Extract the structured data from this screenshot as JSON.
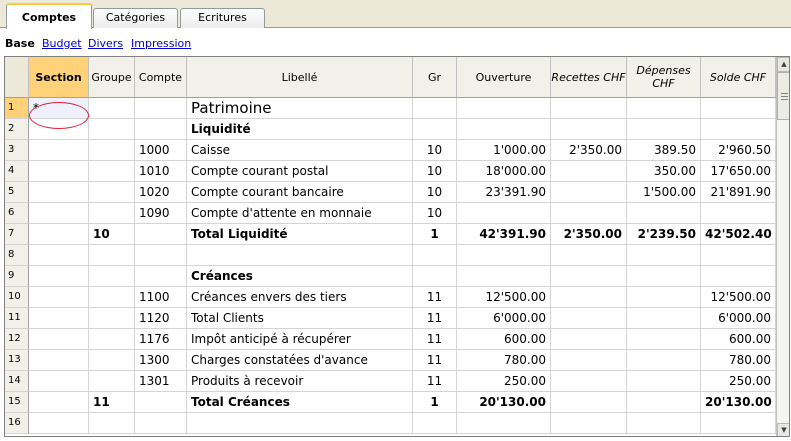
{
  "tabs": [
    {
      "label": "Comptes",
      "active": true
    },
    {
      "label": "Catégories",
      "active": false
    },
    {
      "label": "Ecritures",
      "active": false
    }
  ],
  "views": {
    "current": "Base",
    "links": [
      "Budget",
      "Divers",
      "Impression"
    ]
  },
  "table": {
    "columns": {
      "section": "Section",
      "groupe": "Groupe",
      "compte": "Compte",
      "libelle": "Libellé",
      "gr": "Gr",
      "ouverture": "Ouverture",
      "recettes": "Recettes CHF",
      "depenses": "Dépenses CHF",
      "solde": "Solde CHF"
    },
    "rows": [
      {
        "num": "1",
        "section": "*",
        "groupe": "",
        "compte": "",
        "libelle": "Patrimoine",
        "gr": "",
        "ouverture": "",
        "recettes": "",
        "depenses": "",
        "solde": ""
      },
      {
        "num": "2",
        "section": "",
        "groupe": "",
        "compte": "",
        "libelle": "Liquidité",
        "gr": "",
        "ouverture": "",
        "recettes": "",
        "depenses": "",
        "solde": ""
      },
      {
        "num": "3",
        "section": "",
        "groupe": "",
        "compte": "1000",
        "libelle": "Caisse",
        "gr": "10",
        "ouverture": "1'000.00",
        "recettes": "2'350.00",
        "depenses": "389.50",
        "solde": "2'960.50"
      },
      {
        "num": "4",
        "section": "",
        "groupe": "",
        "compte": "1010",
        "libelle": "Compte courant postal",
        "gr": "10",
        "ouverture": "18'000.00",
        "recettes": "",
        "depenses": "350.00",
        "solde": "17'650.00"
      },
      {
        "num": "5",
        "section": "",
        "groupe": "",
        "compte": "1020",
        "libelle": "Compte courant bancaire",
        "gr": "10",
        "ouverture": "23'391.90",
        "recettes": "",
        "depenses": "1'500.00",
        "solde": "21'891.90"
      },
      {
        "num": "6",
        "section": "",
        "groupe": "",
        "compte": "1090",
        "libelle": "Compte d'attente en monnaie",
        "gr": "10",
        "ouverture": "",
        "recettes": "",
        "depenses": "",
        "solde": ""
      },
      {
        "num": "7",
        "section": "",
        "groupe": "10",
        "compte": "",
        "libelle": "Total Liquidité",
        "gr": "1",
        "ouverture": "42'391.90",
        "recettes": "2'350.00",
        "depenses": "2'239.50",
        "solde": "42'502.40"
      },
      {
        "num": "8",
        "section": "",
        "groupe": "",
        "compte": "",
        "libelle": "",
        "gr": "",
        "ouverture": "",
        "recettes": "",
        "depenses": "",
        "solde": ""
      },
      {
        "num": "9",
        "section": "",
        "groupe": "",
        "compte": "",
        "libelle": "Créances",
        "gr": "",
        "ouverture": "",
        "recettes": "",
        "depenses": "",
        "solde": ""
      },
      {
        "num": "10",
        "section": "",
        "groupe": "",
        "compte": "1100",
        "libelle": "Créances envers des tiers",
        "gr": "11",
        "ouverture": "12'500.00",
        "recettes": "",
        "depenses": "",
        "solde": "12'500.00"
      },
      {
        "num": "11",
        "section": "",
        "groupe": "",
        "compte": "1120",
        "libelle": "Total Clients",
        "gr": "11",
        "ouverture": "6'000.00",
        "recettes": "",
        "depenses": "",
        "solde": "6'000.00"
      },
      {
        "num": "12",
        "section": "",
        "groupe": "",
        "compte": "1176",
        "libelle": "Impôt anticipé à récupérer",
        "gr": "11",
        "ouverture": "600.00",
        "recettes": "",
        "depenses": "",
        "solde": "600.00"
      },
      {
        "num": "13",
        "section": "",
        "groupe": "",
        "compte": "1300",
        "libelle": "Charges constatées d'avance",
        "gr": "11",
        "ouverture": "780.00",
        "recettes": "",
        "depenses": "",
        "solde": "780.00"
      },
      {
        "num": "14",
        "section": "",
        "groupe": "",
        "compte": "1301",
        "libelle": "Produits à recevoir",
        "gr": "11",
        "ouverture": "250.00",
        "recettes": "",
        "depenses": "",
        "solde": "250.00"
      },
      {
        "num": "15",
        "section": "",
        "groupe": "11",
        "compte": "",
        "libelle": "Total Créances",
        "gr": "1",
        "ouverture": "20'130.00",
        "recettes": "",
        "depenses": "",
        "solde": "20'130.00"
      },
      {
        "num": "16",
        "section": "",
        "groupe": "",
        "compte": "",
        "libelle": "",
        "gr": "",
        "ouverture": "",
        "recettes": "",
        "depenses": "",
        "solde": ""
      }
    ]
  },
  "colors": {
    "section_header": "#ffd27a",
    "active_tab_accent": "#ffc83c",
    "highlight_ring": "#e0203c",
    "link": "#0000cc"
  }
}
